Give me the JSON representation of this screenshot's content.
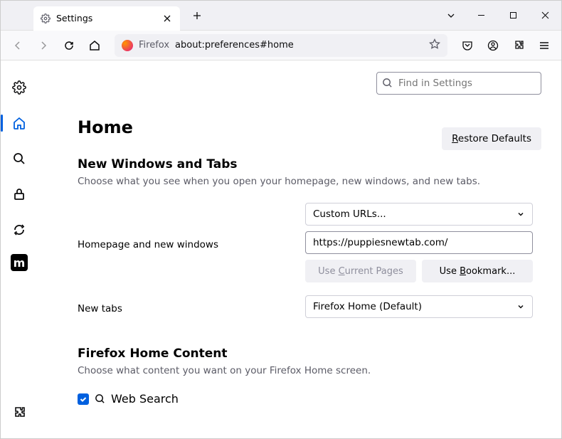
{
  "tab": {
    "title": "Settings"
  },
  "urlbar": {
    "prefix": "Firefox",
    "path": "about:preferences#home"
  },
  "search": {
    "placeholder": "Find in Settings"
  },
  "page_title": "Home",
  "restore": "Restore Defaults",
  "section1": {
    "heading": "New Windows and Tabs",
    "desc": "Choose what you see when you open your homepage, new windows, and new tabs."
  },
  "homepage": {
    "label": "Homepage and new windows",
    "select": "Custom URLs...",
    "url": "https://puppiesnewtab.com/",
    "use_current": "Use Current Pages",
    "use_bookmark": "Use Bookmark..."
  },
  "newtabs": {
    "label": "New tabs",
    "select": "Firefox Home (Default)"
  },
  "section2": {
    "heading": "Firefox Home Content",
    "desc": "Choose what content you want on your Firefox Home screen.",
    "websearch": "Web Search"
  }
}
